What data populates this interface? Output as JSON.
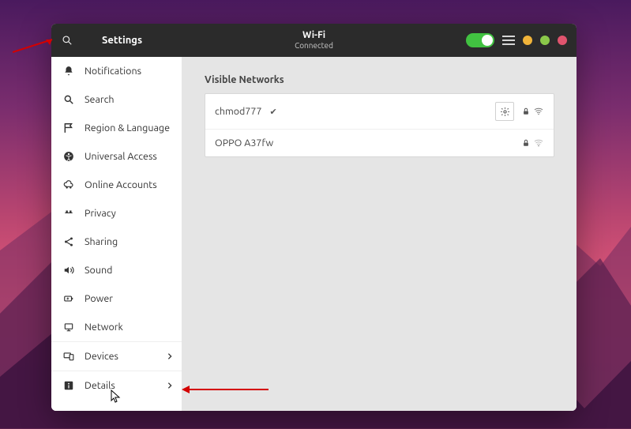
{
  "header": {
    "title_left": "Settings",
    "title_center_main": "Wi-Fi",
    "title_center_sub": "Connected"
  },
  "sidebar": {
    "items": [
      {
        "icon": "bell",
        "label": "Notifications"
      },
      {
        "icon": "search",
        "label": "Search"
      },
      {
        "icon": "flag",
        "label": "Region & Language"
      },
      {
        "icon": "accessibility",
        "label": "Universal Access"
      },
      {
        "icon": "cloud-accounts",
        "label": "Online Accounts"
      },
      {
        "icon": "privacy",
        "label": "Privacy"
      },
      {
        "icon": "share",
        "label": "Sharing"
      },
      {
        "icon": "volume",
        "label": "Sound"
      },
      {
        "icon": "power",
        "label": "Power"
      },
      {
        "icon": "network",
        "label": "Network"
      },
      {
        "icon": "devices",
        "label": "Devices",
        "chevron": true
      },
      {
        "icon": "info",
        "label": "Details",
        "chevron": true
      }
    ]
  },
  "content": {
    "section_title": "Visible Networks",
    "networks": [
      {
        "name": "chmod777",
        "connected": true,
        "locked": true,
        "has_gear": true
      },
      {
        "name": "OPPO A37fw",
        "connected": false,
        "locked": true,
        "has_gear": false
      }
    ]
  }
}
